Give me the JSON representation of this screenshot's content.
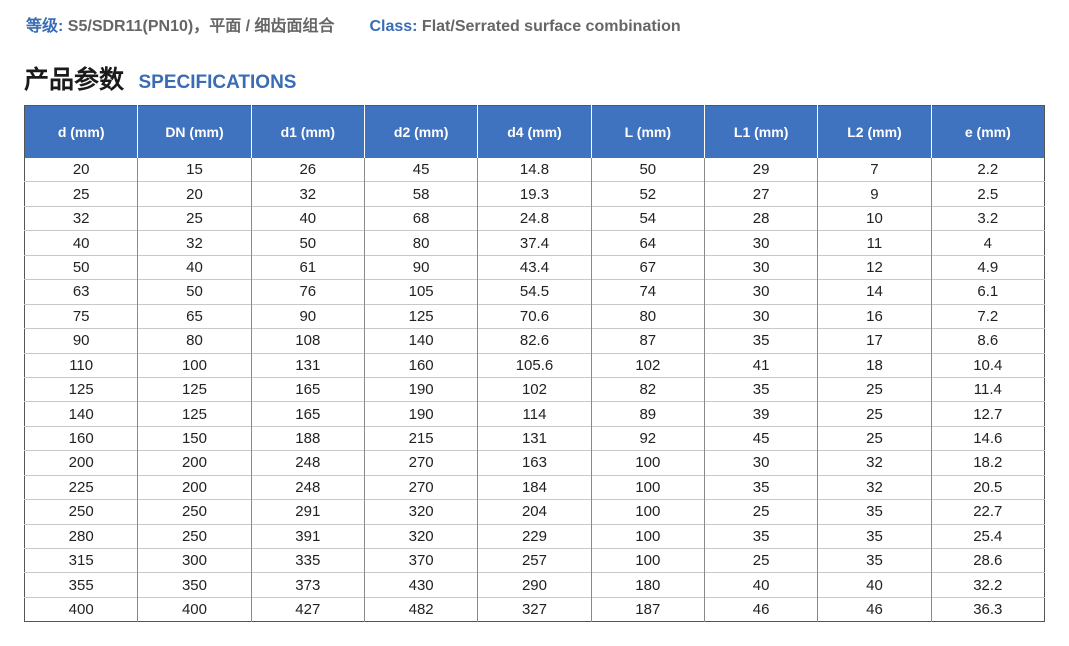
{
  "class_line": {
    "cn_label": "等级:",
    "cn_value": "S5/SDR11(PN10)，平面 / 细齿面组合",
    "en_label": "Class:",
    "en_value": "Flat/Serrated surface combination"
  },
  "section": {
    "title_cn": "产品参数",
    "title_en": "SPECIFICATIONS"
  },
  "table": {
    "headers": [
      "d (mm)",
      "DN (mm)",
      "d1 (mm)",
      "d2 (mm)",
      "d4 (mm)",
      "L (mm)",
      "L1 (mm)",
      "L2 (mm)",
      "e (mm)"
    ],
    "rows": [
      [
        "20",
        "15",
        "26",
        "45",
        "14.8",
        "50",
        "29",
        "7",
        "2.2"
      ],
      [
        "25",
        "20",
        "32",
        "58",
        "19.3",
        "52",
        "27",
        "9",
        "2.5"
      ],
      [
        "32",
        "25",
        "40",
        "68",
        "24.8",
        "54",
        "28",
        "10",
        "3.2"
      ],
      [
        "40",
        "32",
        "50",
        "80",
        "37.4",
        "64",
        "30",
        "11",
        "4"
      ],
      [
        "50",
        "40",
        "61",
        "90",
        "43.4",
        "67",
        "30",
        "12",
        "4.9"
      ],
      [
        "63",
        "50",
        "76",
        "105",
        "54.5",
        "74",
        "30",
        "14",
        "6.1"
      ],
      [
        "75",
        "65",
        "90",
        "125",
        "70.6",
        "80",
        "30",
        "16",
        "7.2"
      ],
      [
        "90",
        "80",
        "108",
        "140",
        "82.6",
        "87",
        "35",
        "17",
        "8.6"
      ],
      [
        "110",
        "100",
        "131",
        "160",
        "105.6",
        "102",
        "41",
        "18",
        "10.4"
      ],
      [
        "125",
        "125",
        "165",
        "190",
        "102",
        "82",
        "35",
        "25",
        "11.4"
      ],
      [
        "140",
        "125",
        "165",
        "190",
        "114",
        "89",
        "39",
        "25",
        "12.7"
      ],
      [
        "160",
        "150",
        "188",
        "215",
        "131",
        "92",
        "45",
        "25",
        "14.6"
      ],
      [
        "200",
        "200",
        "248",
        "270",
        "163",
        "100",
        "30",
        "32",
        "18.2"
      ],
      [
        "225",
        "200",
        "248",
        "270",
        "184",
        "100",
        "35",
        "32",
        "20.5"
      ],
      [
        "250",
        "250",
        "291",
        "320",
        "204",
        "100",
        "25",
        "35",
        "22.7"
      ],
      [
        "280",
        "250",
        "391",
        "320",
        "229",
        "100",
        "35",
        "35",
        "25.4"
      ],
      [
        "315",
        "300",
        "335",
        "370",
        "257",
        "100",
        "25",
        "35",
        "28.6"
      ],
      [
        "355",
        "350",
        "373",
        "430",
        "290",
        "180",
        "40",
        "40",
        "32.2"
      ],
      [
        "400",
        "400",
        "427",
        "482",
        "327",
        "187",
        "46",
        "46",
        "36.3"
      ]
    ]
  }
}
